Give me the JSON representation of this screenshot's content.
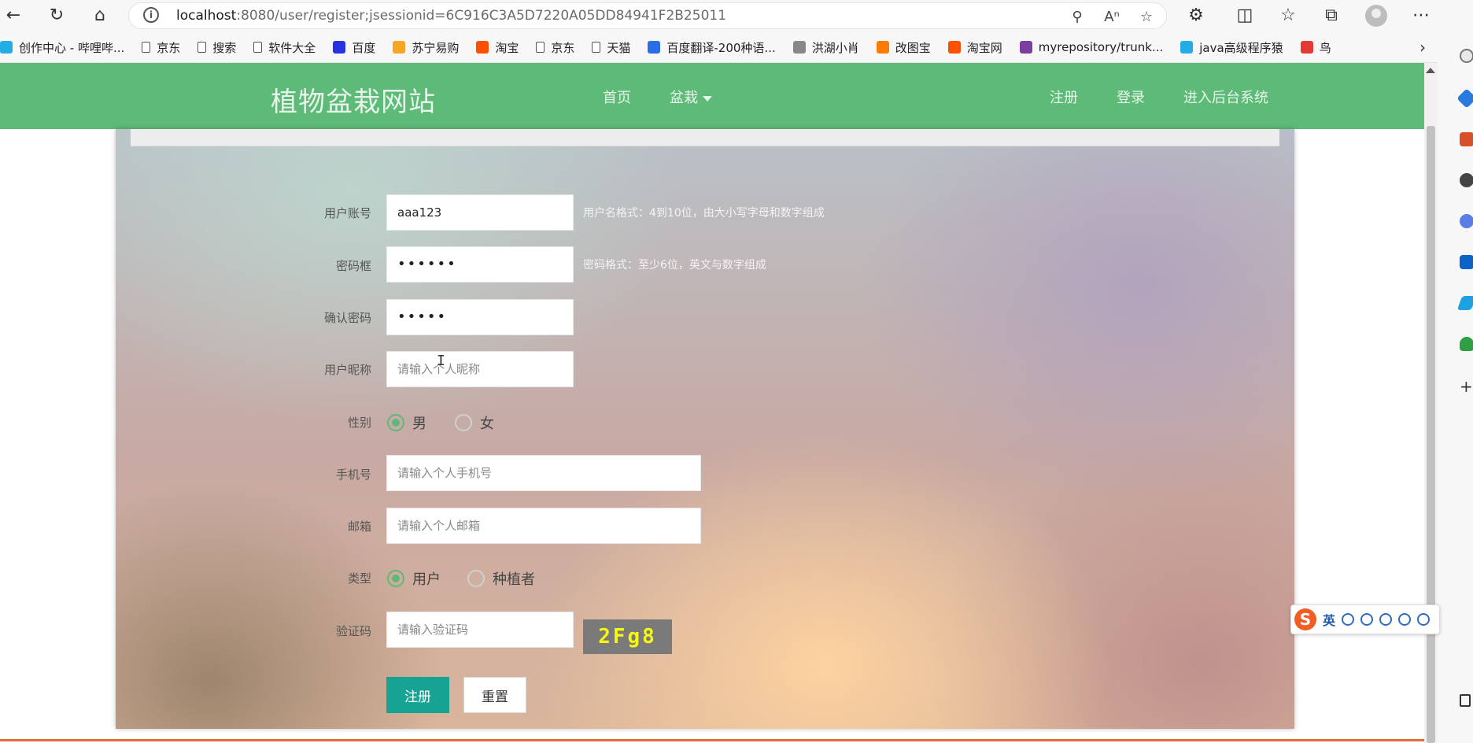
{
  "browser": {
    "url_host": "localhost",
    "url_rest": ":8080/user/register;jsessionid=6C916C3A5D7220A05DD84941F2B25011"
  },
  "bookmarks": [
    {
      "label": "创作中心 - 哔哩哔...",
      "color": "#23ade5"
    },
    {
      "label": "京东",
      "color": "doc"
    },
    {
      "label": "搜索",
      "color": "doc"
    },
    {
      "label": "软件大全",
      "color": "doc"
    },
    {
      "label": "百度",
      "color": "#2932e1"
    },
    {
      "label": "苏宁易购",
      "color": "#f5a623"
    },
    {
      "label": "淘宝",
      "color": "#ff5000"
    },
    {
      "label": "京东",
      "color": "doc"
    },
    {
      "label": "天猫",
      "color": "doc"
    },
    {
      "label": "百度翻译-200种语...",
      "color": "#2b6de8"
    },
    {
      "label": "洪湖小肖",
      "color": "#888888"
    },
    {
      "label": "改图宝",
      "color": "#ff7a00"
    },
    {
      "label": "淘宝网",
      "color": "#ff5000"
    },
    {
      "label": "myrepository/trunk...",
      "color": "#7b3fa0"
    },
    {
      "label": "java高级程序猿",
      "color": "#23ade5"
    },
    {
      "label": "鸟",
      "color": "#e53935"
    }
  ],
  "nav": {
    "brand": "植物盆栽网站",
    "home": "首页",
    "bonsai": "盆栽",
    "register": "注册",
    "login": "登录",
    "admin": "进入后台系统"
  },
  "form": {
    "username_label": "用户账号",
    "username_value": "aaa123",
    "username_hint": "用户名格式：4到10位，由大小写字母和数字组成",
    "password_label": "密码框",
    "password_value": "••••••",
    "password_hint": "密码格式：至少6位，英文与数字组成",
    "confirm_label": "确认密码",
    "confirm_value": "•••••",
    "nickname_label": "用户昵称",
    "nickname_placeholder": "请输入个人昵称",
    "gender_label": "性别",
    "gender_male": "男",
    "gender_female": "女",
    "phone_label": "手机号",
    "phone_placeholder": "请输入个人手机号",
    "email_label": "邮箱",
    "email_placeholder": "请输入个人邮箱",
    "type_label": "类型",
    "type_user": "用户",
    "type_grower": "种植者",
    "captcha_label": "验证码",
    "captcha_placeholder": "请输入验证码",
    "captcha_text": "2Fg8",
    "submit": "注册",
    "reset": "重置"
  },
  "ime": {
    "mode": "英"
  },
  "colors": {
    "nav_green": "#5dba77",
    "primary_button": "#16a393",
    "radio_checked": "#5fb878",
    "captcha_text": "#f7f711"
  }
}
